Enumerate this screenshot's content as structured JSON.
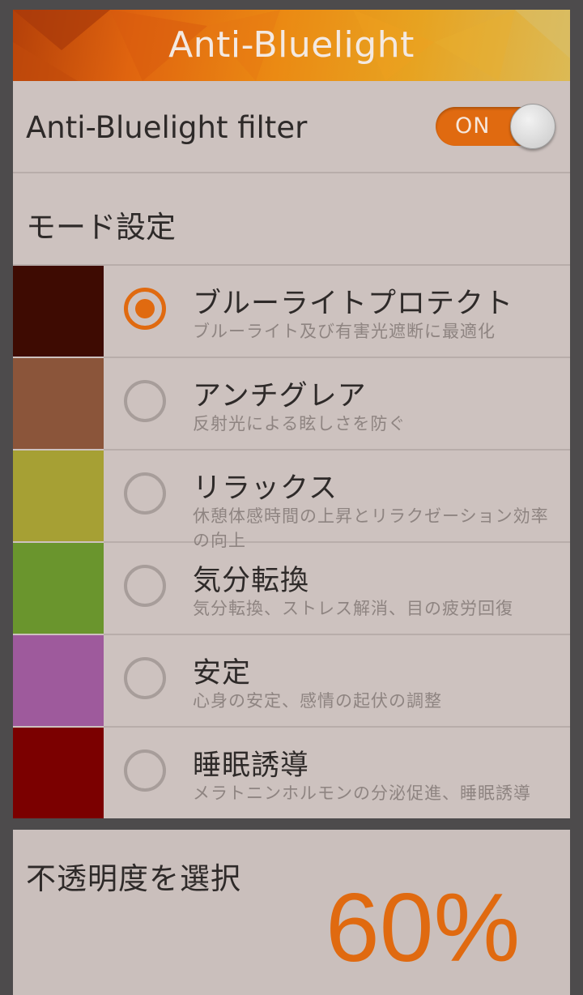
{
  "header": {
    "title": "Anti-Bluelight"
  },
  "filter": {
    "label": "Anti-Bluelight filter",
    "toggle_text": "ON",
    "enabled": true
  },
  "mode_section": {
    "label": "モード設定"
  },
  "modes": [
    {
      "title": "ブルーライトプロテクト",
      "desc": "ブルーライト及び有害光遮断に最適化",
      "color": "#3e0b02",
      "selected": true
    },
    {
      "title": "アンチグレア",
      "desc": "反射光による眩しさを防ぐ",
      "color": "#8b553a",
      "selected": false
    },
    {
      "title": "リラックス",
      "desc": "休憩体感時間の上昇とリラクゼーション効率の向上",
      "color": "#a6a034",
      "selected": false
    },
    {
      "title": "気分転換",
      "desc": "気分転換、ストレス解消、目の疲労回復",
      "color": "#6a952d",
      "selected": false
    },
    {
      "title": "安定",
      "desc": "心身の安定、感情の起伏の調整",
      "color": "#9e5a9c",
      "selected": false
    },
    {
      "title": "睡眠誘導",
      "desc": "メラトニンホルモンの分泌促進、睡眠誘導",
      "color": "#7b0000",
      "selected": false
    }
  ],
  "opacity": {
    "label": "不透明度を選択",
    "value": "60%"
  },
  "colors": {
    "accent": "#e06a10",
    "panel": "#cdc2bf",
    "background": "#4d4b4c"
  }
}
